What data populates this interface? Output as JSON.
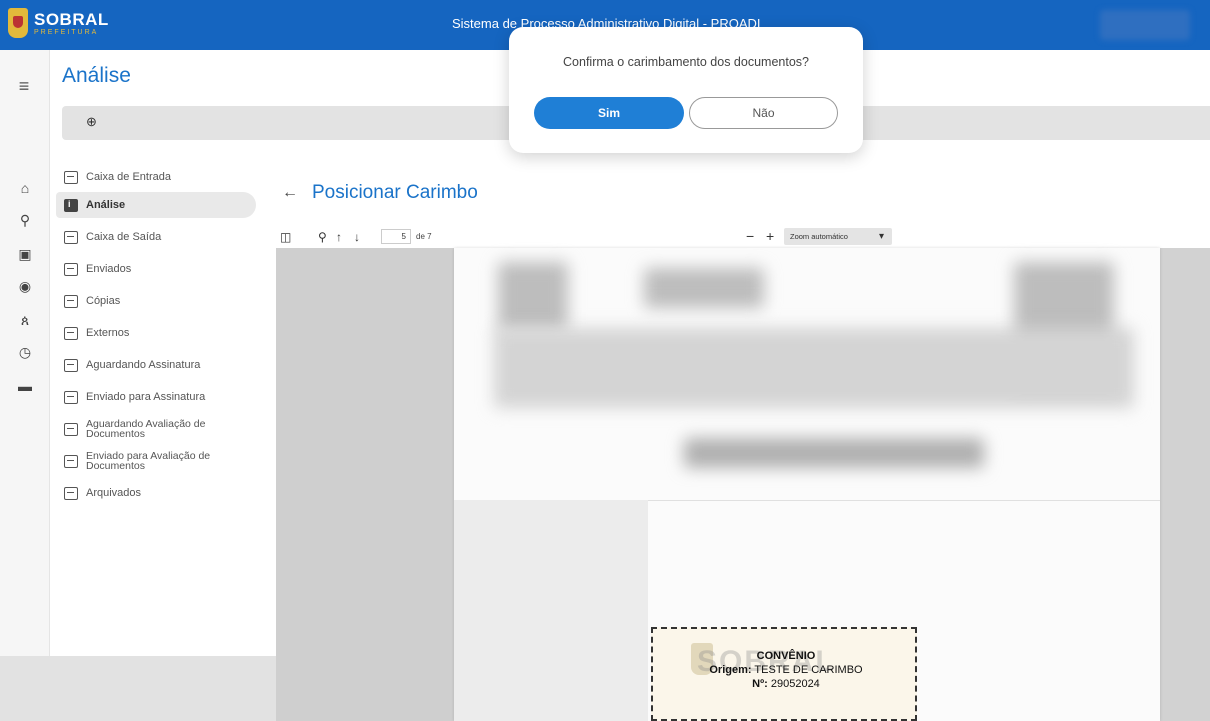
{
  "topbar": {
    "logo_main": "SOBRAL",
    "logo_sub": "PREFEITURA",
    "system_title": "Sistema de Processo Administrativo Digital - PROADI"
  },
  "page": {
    "title": "Análise"
  },
  "nav": {
    "items": [
      {
        "label": "Caixa de Entrada"
      },
      {
        "label": "Análise"
      },
      {
        "label": "Caixa de Saída"
      },
      {
        "label": "Enviados"
      },
      {
        "label": "Cópias"
      },
      {
        "label": "Externos"
      },
      {
        "label": "Aguardando Assinatura"
      },
      {
        "label": "Enviado para Assinatura"
      },
      {
        "label": "Aguardando Avaliação de Documentos"
      },
      {
        "label": "Enviado para Avaliação de Documentos"
      },
      {
        "label": "Arquivados"
      }
    ]
  },
  "document": {
    "title": "Posicionar Carimbo",
    "current_page": "5",
    "page_of": "de 7",
    "zoom": "Zoom automático"
  },
  "stamp": {
    "title": "CONVÊNIO",
    "origin_label": "Origem:",
    "origin_value": "TESTE DE CARIMBO",
    "number_label": "Nº:",
    "number_value": "29052024",
    "watermark": "SOBRAL"
  },
  "modal": {
    "message": "Confirma o carimbamento dos documentos?",
    "yes_label": "Sim",
    "no_label": "Não"
  },
  "colors": {
    "primary": "#1565c0",
    "accent": "#1a73c9",
    "yes_button": "#1f7fd6"
  }
}
